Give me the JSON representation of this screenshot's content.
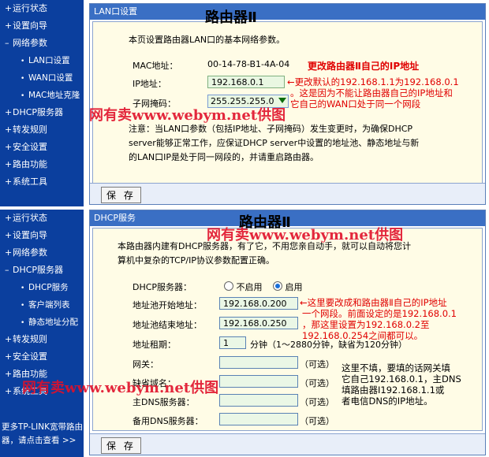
{
  "sidebar_top": {
    "items": [
      {
        "label": "运行状态",
        "sub": false
      },
      {
        "label": "设置向导",
        "sub": false
      },
      {
        "label": "网络参数",
        "sub": false,
        "expanded": true
      },
      {
        "label": "LAN口设置",
        "sub": true
      },
      {
        "label": "WAN口设置",
        "sub": true
      },
      {
        "label": "MAC地址克隆",
        "sub": true
      },
      {
        "label": "DHCP服务器",
        "sub": false
      },
      {
        "label": "转发规则",
        "sub": false
      },
      {
        "label": "安全设置",
        "sub": false
      },
      {
        "label": "路由功能",
        "sub": false
      },
      {
        "label": "系统工具",
        "sub": false
      }
    ]
  },
  "sidebar_bottom": {
    "items": [
      {
        "label": "运行状态",
        "sub": false
      },
      {
        "label": "设置向导",
        "sub": false
      },
      {
        "label": "网络参数",
        "sub": false
      },
      {
        "label": "DHCP服务器",
        "sub": false,
        "expanded": true
      },
      {
        "label": "DHCP服务",
        "sub": true
      },
      {
        "label": "客户端列表",
        "sub": true
      },
      {
        "label": "静态地址分配",
        "sub": true
      },
      {
        "label": "转发规则",
        "sub": false
      },
      {
        "label": "安全设置",
        "sub": false
      },
      {
        "label": "路由功能",
        "sub": false
      },
      {
        "label": "系统工具",
        "sub": false
      }
    ],
    "footer_line1": "更多TP-LINK宽带路由",
    "footer_line2": "器，请点击查看 >>"
  },
  "lan_panel": {
    "title": "LAN口设置",
    "heading": "路由器Ⅱ",
    "desc": "本页设置路由器LAN口的基本网络参数。",
    "mac_label": "MAC地址：",
    "mac_value": "00-14-78-B1-4A-04",
    "ip_label": "IP地址：",
    "ip_value": "192.168.0.1",
    "mask_label": "子网掩码：",
    "mask_value": "255.255.255.0",
    "note_line1": "注意：当LAN口参数（包括IP地址、子网掩码）发生变更时，为确保DHCP",
    "note_line2": "server能够正常工作，应保证DHCP server中设置的地址池、静态地址与新",
    "note_line3": "的LAN口IP是处于同一网段的，并请重启路由器。",
    "save_label": "保 存",
    "annotation_title": "更改路由器Ⅱ自己的IP地址",
    "annotation_line1": "←更改默认的192.168.1.1为192.168.0.1",
    "annotation_line2": "。这是因为不能让路由器自己的IP地址和",
    "annotation_line3": "它自己的WAN口处于同一个网段"
  },
  "dhcp_panel": {
    "title": "DHCP服务",
    "heading": "路由器Ⅱ",
    "desc_line1": "本路由器内建有DHCP服务器，有了它，不用您亲自动手，就可以自动将您计",
    "desc_line2": "算机中复杂的TCP/IP协议参数配置正确。",
    "server_label": "DHCP服务器：",
    "radio_off": "不启用",
    "radio_on": "启用",
    "start_label": "地址池开始地址：",
    "start_value": "192.168.0.200",
    "end_label": "地址池结束地址：",
    "end_value": "192.168.0.250",
    "lease_label": "地址租期：",
    "lease_value": "1",
    "lease_hint": "分钟（1～2880分钟，缺省为120分钟）",
    "gateway_label": "网关：",
    "domain_label": "缺省域名：",
    "dns1_label": "主DNS服务器：",
    "dns2_label": "备用DNS服务器：",
    "optional": "（可选）",
    "save_label": "保 存",
    "annotation_line1": "←这里要改成和路由器Ⅱ自己的IP地址",
    "annotation_line2": "一个网段。前面设定的是192.168.0.1",
    "annotation_line3": "，那这里设置为192.168.0.2至",
    "annotation_line4": "192.168.0.254之间都可以。",
    "note_line1": "这里不填，要填的话网关填",
    "note_line2": "它自己192.168.0.1，主DNS",
    "note_line3": "填路由器Ⅰ192.168.1.1或",
    "note_line4": "者电信DNS的IP地址。"
  },
  "watermarks": [
    "网有卖www.webym.net供图",
    "网有卖www.webym.net供图",
    "网有卖www.webym.net供图"
  ]
}
